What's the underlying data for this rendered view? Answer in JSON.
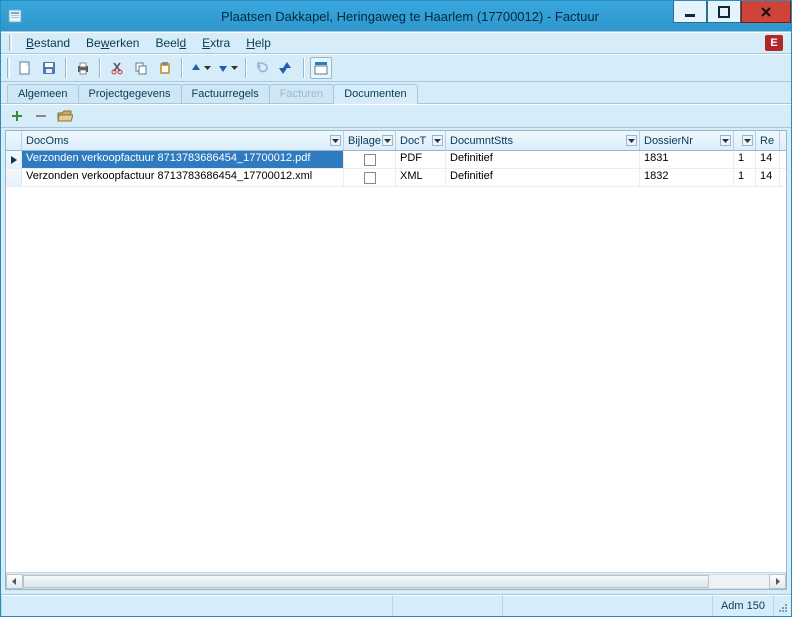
{
  "window": {
    "title": "Plaatsen Dakkapel, Heringaweg te Haarlem (17700012) - Factuur"
  },
  "menu": {
    "bestand": "Bestand",
    "bewerken": "Bewerken",
    "beeld": "Beeld",
    "extra": "Extra",
    "help": "Help"
  },
  "brand": {
    "letter": "E"
  },
  "tabs": {
    "algemeen": "Algemeen",
    "projectgegevens": "Projectgegevens",
    "factuurregels": "Factuurregels",
    "facturen": "Facturen",
    "documenten": "Documenten"
  },
  "columns": {
    "docoms": "DocOms",
    "bijlage": "Bijlage",
    "doct": "DocT",
    "documntstts": "DocumntStts",
    "dossiernr": "DossierNr",
    "extra": "",
    "re": "Re"
  },
  "rows": [
    {
      "docoms": "Verzonden verkoopfactuur 8713783686454_17700012.pdf",
      "bijlage_checked": false,
      "doct": "PDF",
      "documntstts": "Definitief",
      "dossiernr": "1831",
      "extra": "1",
      "re": "14",
      "selected": true
    },
    {
      "docoms": "Verzonden verkoopfactuur 8713783686454_17700012.xml",
      "bijlage_checked": false,
      "doct": "XML",
      "documntstts": "Definitief",
      "dossiernr": "1832",
      "extra": "1",
      "re": "14",
      "selected": false
    }
  ],
  "status": {
    "adm": "Adm 150"
  },
  "col_widths": {
    "docoms": 322,
    "bijlage": 52,
    "doct": 50,
    "documntstts": 194,
    "dossiernr": 94,
    "extra": 22,
    "re": 24
  }
}
